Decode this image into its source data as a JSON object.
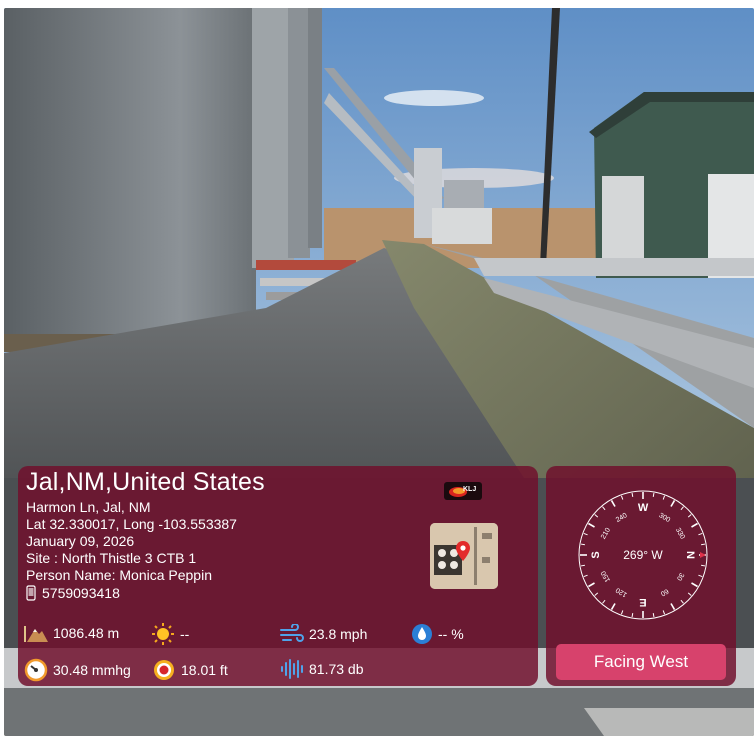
{
  "location": {
    "title": "Jal,NM,United States",
    "address": "Harmon Ln, Jal, NM",
    "coords": "Lat 32.330017, Long -103.553387",
    "date": "January 09, 2026",
    "site": "Site : North Thistle 3 CTB 1",
    "person": "Person Name: Monica Peppin",
    "phone": "5759093418"
  },
  "logo_text": "KLJ",
  "metrics": {
    "elevation": "1086.48 m",
    "weather": "--",
    "wind": "23.8 mph",
    "humidity": "-- %",
    "pressure": "30.48 mmhg",
    "altitude_ft": "18.01 ft",
    "noise": "81.73 db"
  },
  "compass": {
    "heading": "269° W",
    "facing_label": "Facing West",
    "cardinals": {
      "n": "N",
      "e": "E",
      "s": "S",
      "w": "W"
    },
    "degree_labels": [
      "30",
      "60",
      "120",
      "150",
      "210",
      "240",
      "300",
      "330"
    ]
  },
  "colors": {
    "card_bg": "#70102c",
    "button": "#d7426c",
    "needle": "#e0314a"
  },
  "icons": {
    "elevation": "mountain-icon",
    "weather": "sun-icon",
    "wind": "wind-icon",
    "humidity": "humidity-icon",
    "pressure": "gauge-icon",
    "altitude": "target-icon",
    "noise": "sound-wave-icon",
    "phone": "phone-icon",
    "map": "map-pin-icon"
  }
}
